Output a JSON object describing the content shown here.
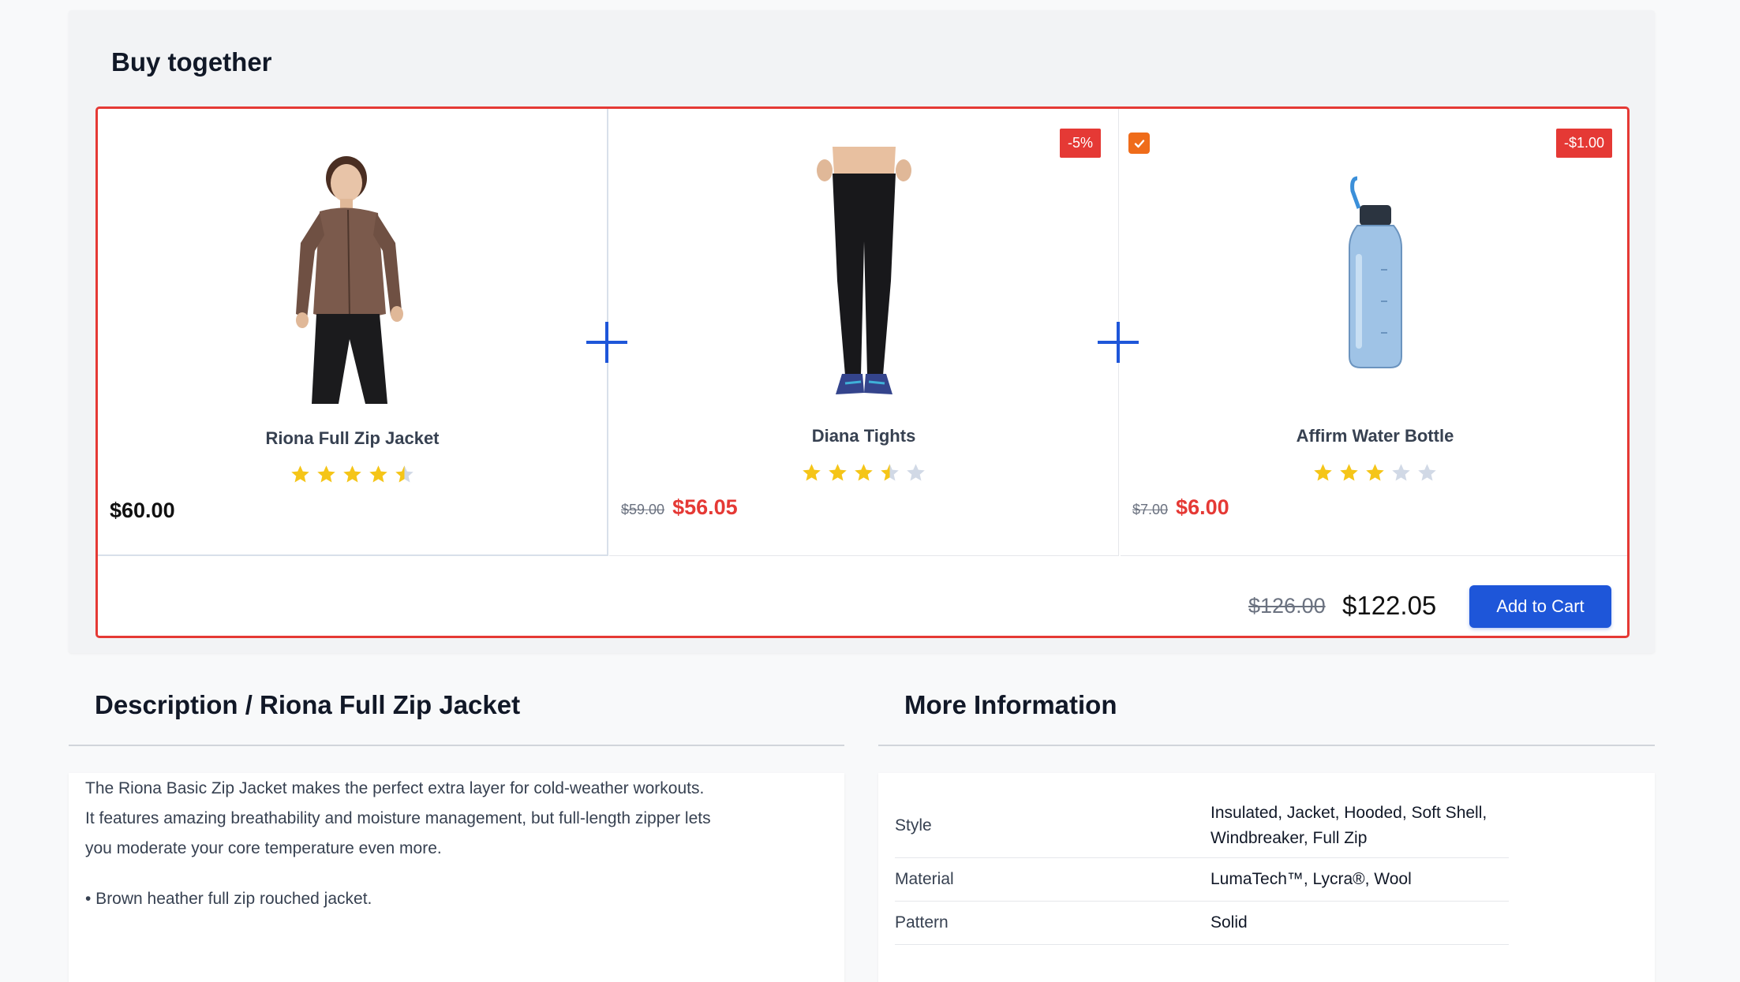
{
  "buy_together": {
    "title": "Buy together",
    "products": [
      {
        "name": "Riona Full Zip Jacket",
        "rating": 4.5,
        "price": "$60.00"
      },
      {
        "name": "Diana Tights",
        "rating": 3.5,
        "old_price": "$59.00",
        "price": "$56.05",
        "discount_badge": "-5%"
      },
      {
        "name": "Affirm Water Bottle",
        "rating": 3,
        "old_price": "$7.00",
        "price": "$6.00",
        "discount_badge": "-$1.00",
        "checked": true
      }
    ],
    "total_old": "$126.00",
    "total_new": "$122.05",
    "add_to_cart_label": "Add to Cart"
  },
  "description": {
    "title": "Description / Riona Full Zip Jacket",
    "paragraph": "The Riona Basic Zip Jacket makes the perfect extra layer for cold-weather workouts. It features amazing breathability and moisture management, but full-length zipper lets you moderate your core temperature even more.",
    "bullet": "• Brown heather full zip rouched jacket."
  },
  "more_info": {
    "title": "More Information",
    "rows": [
      {
        "label": "Style",
        "value": "Insulated, Jacket, Hooded, Soft Shell, Windbreaker, Full Zip"
      },
      {
        "label": "Material",
        "value": "LumaTech™, Lycra®, Wool"
      },
      {
        "label": "Pattern",
        "value": "Solid"
      }
    ]
  },
  "colors": {
    "accent": "#1e56d9",
    "sale": "#e53935",
    "star_filled": "#f5c518",
    "star_empty": "#d1d9e6",
    "checkbox": "#ef6c1a"
  }
}
